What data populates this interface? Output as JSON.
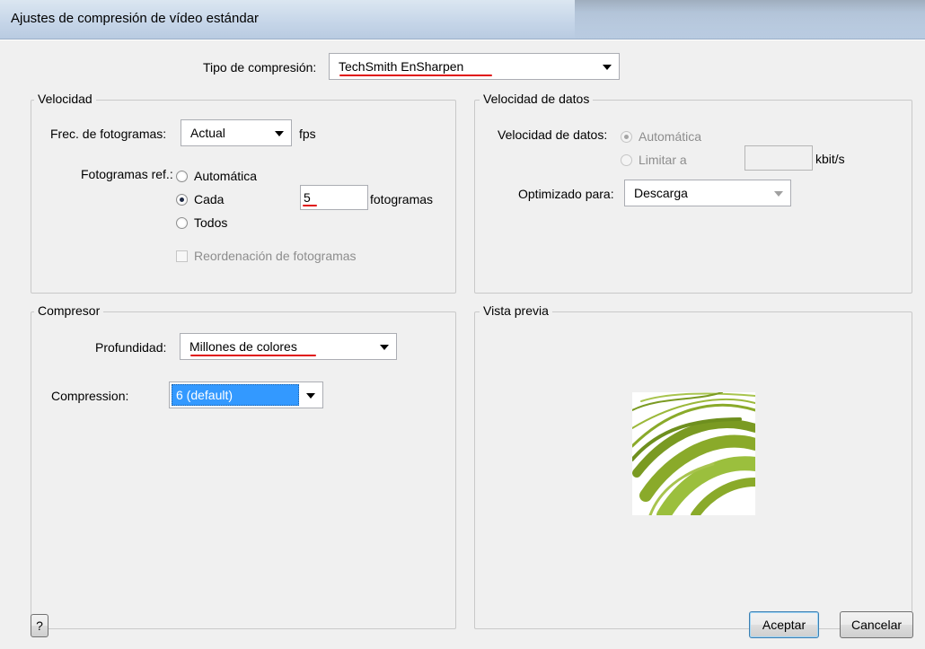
{
  "window": {
    "title": "Ajustes de compresión de vídeo estándar"
  },
  "compression_type": {
    "label": "Tipo de compresión:",
    "value": "TechSmith EnSharpen"
  },
  "speed_group": {
    "title": "Velocidad",
    "frame_rate_label": "Frec. de fotogramas:",
    "frame_rate_value": "Actual",
    "fps_unit": "fps",
    "keyframes_label": "Fotogramas ref.:",
    "option_auto": "Automática",
    "option_every": "Cada",
    "option_all": "Todos",
    "every_value": "5",
    "frames_unit": "fotogramas",
    "reorder_label": "Reordenación de fotogramas",
    "selected_option": "Cada"
  },
  "data_rate_group": {
    "title": "Velocidad de datos",
    "data_rate_label": "Velocidad de datos:",
    "option_auto": "Automática",
    "option_limit": "Limitar a",
    "limit_value": "",
    "unit": "kbit/s",
    "optimized_label": "Optimizado para:",
    "optimized_value": "Descarga"
  },
  "compressor_group": {
    "title": "Compresor",
    "depth_label": "Profundidad:",
    "depth_value": "Millones de colores",
    "compression_label": "Compression:",
    "compression_value": "6 (default)"
  },
  "preview_group": {
    "title": "Vista previa"
  },
  "buttons": {
    "help": "?",
    "ok": "Aceptar",
    "cancel": "Cancelar"
  },
  "colors": {
    "accent_red": "#e01010",
    "selection_blue": "#3399ff",
    "preview_green": "#8aaa2a"
  }
}
